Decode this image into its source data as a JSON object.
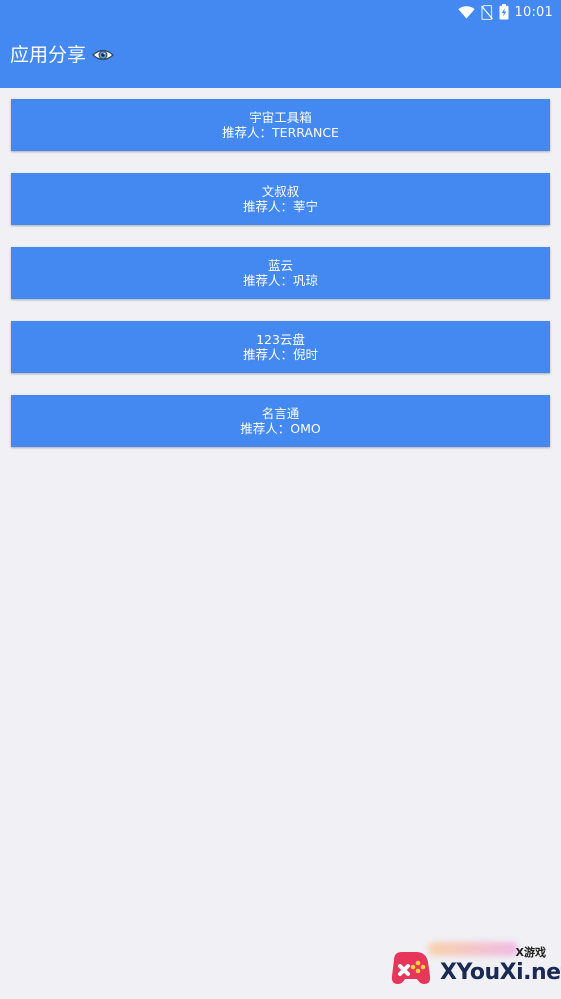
{
  "status_bar": {
    "time": "10:01",
    "icons": [
      "wifi-icon",
      "no-sim-icon",
      "battery-charging-icon"
    ]
  },
  "app_bar": {
    "title": "应用分享",
    "title_icon": "eye-icon"
  },
  "apps": [
    {
      "name": "宇宙工具箱",
      "recommender": "推荐人：TERRANCE"
    },
    {
      "name": "文叔叔",
      "recommender": "推荐人：莘宁"
    },
    {
      "name": "蓝云",
      "recommender": "推荐人：巩琼"
    },
    {
      "name": "123云盘",
      "recommender": "推荐人：倪时"
    },
    {
      "name": "名言通",
      "recommender": "推荐人：OMO"
    }
  ],
  "watermark": {
    "small_text": "X游戏",
    "brand_text": "XYouXi.net"
  },
  "colors": {
    "primary": "#4488f2",
    "background": "#f0f0f5",
    "text_on_primary": "#ffffff"
  }
}
